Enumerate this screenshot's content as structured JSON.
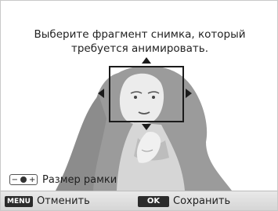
{
  "instruction": {
    "line1": "Выберите фрагмент снимка, который",
    "line2": "требуется анимировать."
  },
  "zoom": {
    "icon_minus": "−",
    "icon_plus": "+",
    "label": "Размер рамки"
  },
  "bottom_bar": {
    "menu_key": "MENU",
    "cancel_label": "Отменить",
    "ok_key": "OK",
    "save_label": "Сохранить"
  },
  "icons": [
    "arrow-up-icon",
    "arrow-down-icon",
    "arrow-left-icon",
    "arrow-right-icon",
    "zoom-icon"
  ],
  "colors": {
    "photo_gray": "#9a9a9a",
    "photo_shadow": "#6f6f6f",
    "frame": "#1b1b1b",
    "bar_bg": "#dcdcdc"
  }
}
